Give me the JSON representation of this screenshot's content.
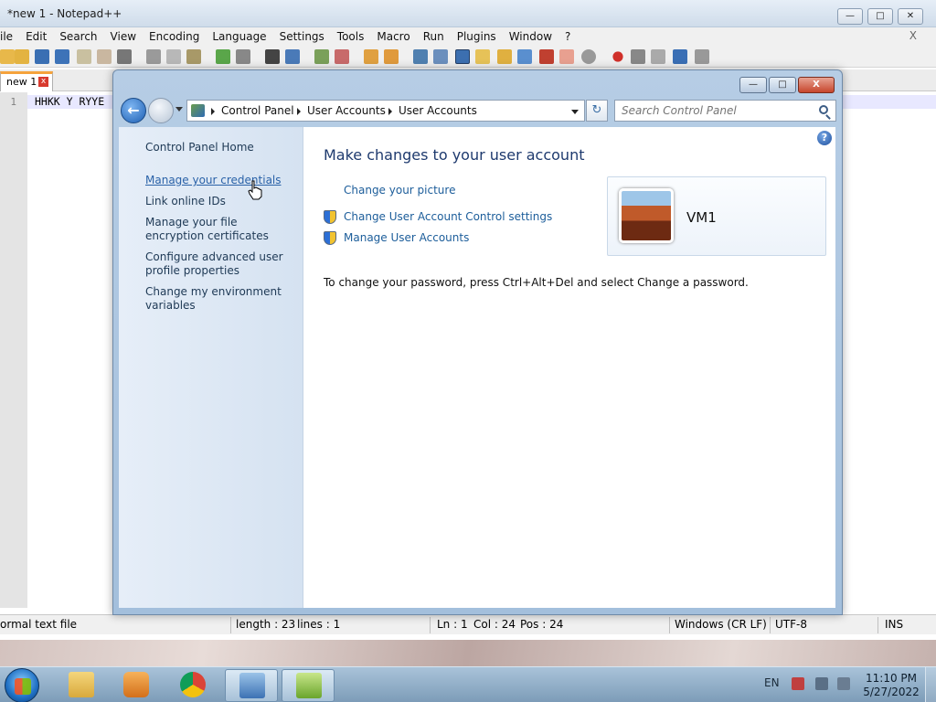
{
  "notepad": {
    "title": "*new 1 - Notepad++",
    "menu": [
      "ile",
      "Edit",
      "Search",
      "View",
      "Encoding",
      "Language",
      "Settings",
      "Tools",
      "Macro",
      "Run",
      "Plugins",
      "Window",
      "?"
    ],
    "menu_close": "X",
    "tab_label": "new 1",
    "tab_close": "x",
    "line_number": "1",
    "line_text": "HHKK Y RYYE",
    "status": {
      "file_type": "ormal text file",
      "length": "length : 23",
      "lines": "lines : 1",
      "ln": "Ln : 1",
      "col": "Col : 24",
      "pos": "Pos : 24",
      "eol": "Windows (CR LF)",
      "encoding": "UTF-8",
      "ins": "INS"
    }
  },
  "control_panel": {
    "breadcrumb": [
      "Control Panel",
      "User Accounts",
      "User Accounts"
    ],
    "search_placeholder": "Search Control Panel",
    "refresh_glyph": "↻",
    "back_glyph": "←",
    "help_glyph": "?",
    "sidebar": [
      {
        "label": "Control Panel Home"
      },
      {
        "label": "Manage your credentials"
      },
      {
        "label": "Link online IDs"
      },
      {
        "label": "Manage your file encryption certificates"
      },
      {
        "label": "Configure advanced user profile properties"
      },
      {
        "label": "Change my environment variables"
      }
    ],
    "heading": "Make changes to your user account",
    "links": [
      {
        "label": "Change your picture",
        "shield": false
      },
      {
        "label": "Change User Account Control settings",
        "shield": true
      },
      {
        "label": "Manage User Accounts",
        "shield": true
      }
    ],
    "account_name": "VM1",
    "password_note": "To change your password, press Ctrl+Alt+Del and select Change a password.",
    "window_buttons": {
      "minimize": "—",
      "maximize": "□",
      "close": "X"
    }
  },
  "taskbar": {
    "language": "EN",
    "time": "11:10 PM",
    "date": "5/27/2022"
  },
  "colors": {
    "link": "#1c5d9a",
    "heading": "#1e3a6e",
    "sidebar_link": "#1e3955"
  }
}
